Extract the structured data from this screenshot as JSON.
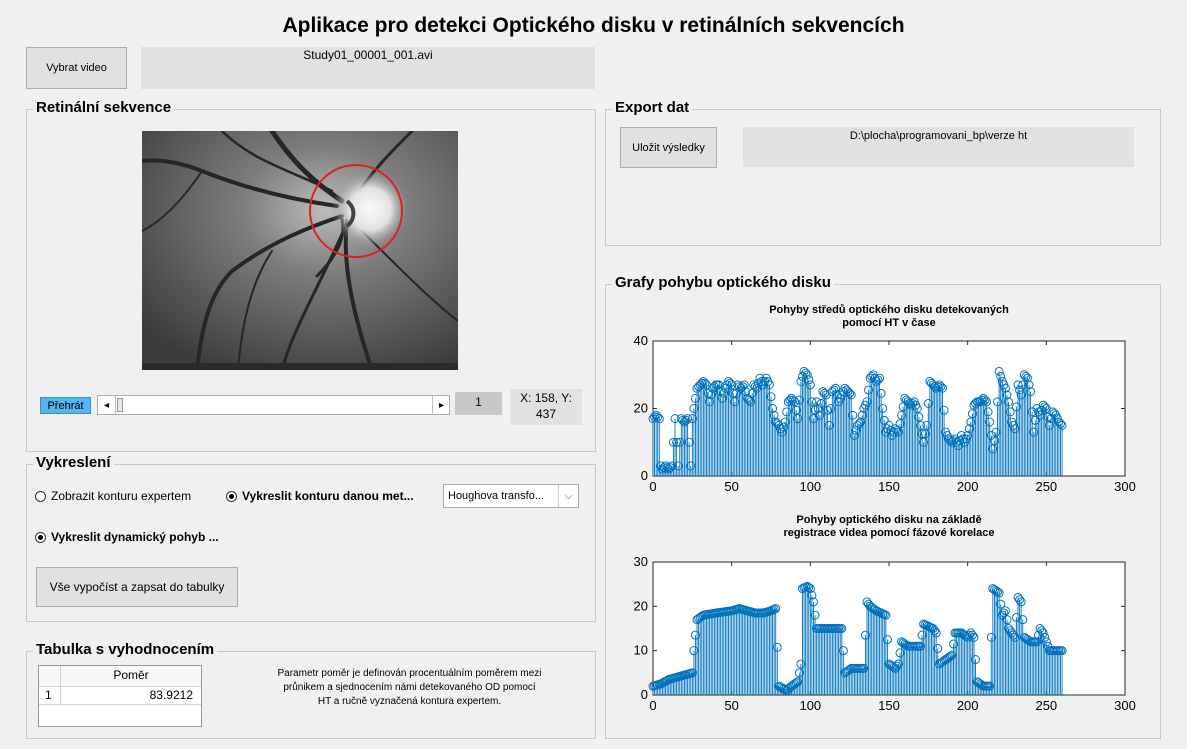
{
  "app_title": "Aplikace pro detekci Optického disku v retinálních sekvencích",
  "select_video_label": "Vybrat video",
  "video_filename": "Study01_00001_001.avi",
  "retina_panel": {
    "title": "Retinální sekvence",
    "play_label": "Přehrát",
    "frame_value": "1",
    "coords": "X: 158, Y: 437"
  },
  "export_panel": {
    "title": "Export dat",
    "save_label": "Uložit výsledky",
    "path": "D:\\plocha\\programovani_bp\\verze ht"
  },
  "draw_panel": {
    "title": "Vykreslení",
    "radio_expert": "Zobrazit konturu expertem",
    "radio_method": "Vykreslit konturu danou met...",
    "method_select": "Houghova transfo...",
    "radio_dynamic": "Vykreslit dynamický pohyb ...",
    "compute_label": "Vše vypočíst a zapsat do tabulky"
  },
  "table_panel": {
    "title": "Tabulka s vyhodnocením",
    "header": "Poměr",
    "row_index": "1",
    "row_value": "83.9212",
    "description_lines": [
      "Parametr poměr je definován procentuálním poměrem mezi",
      "průnikem a sjednocením námi detekovaného OD pomocí",
      "HT a ručně vyznačená kontura expertem."
    ]
  },
  "graphs_panel": {
    "title": "Grafy pohybu optického disku"
  },
  "colors": {
    "stem": "#0072bd",
    "play_button": "#56b4f0",
    "contour": "#e02020"
  },
  "chart_data": [
    {
      "type": "stem",
      "title_lines": [
        "Pohyby středů optického disku detekovaných",
        "pomocí HT v čase"
      ],
      "xlim": [
        0,
        300
      ],
      "ylim": [
        0,
        40
      ],
      "xticks": [
        0,
        50,
        100,
        150,
        200,
        250,
        300
      ],
      "yticks": [
        0,
        20,
        40
      ],
      "anchors": [
        [
          0,
          17
        ],
        [
          2,
          18
        ],
        [
          4,
          17
        ],
        [
          5,
          3
        ],
        [
          6,
          2
        ],
        [
          8,
          3
        ],
        [
          10,
          2
        ],
        [
          12,
          3
        ],
        [
          14,
          17
        ],
        [
          16,
          3
        ],
        [
          18,
          17
        ],
        [
          20,
          16
        ],
        [
          22,
          17
        ],
        [
          24,
          3
        ],
        [
          25,
          17
        ],
        [
          26,
          20
        ],
        [
          28,
          26
        ],
        [
          30,
          27
        ],
        [
          32,
          28
        ],
        [
          34,
          27
        ],
        [
          36,
          22
        ],
        [
          38,
          26
        ],
        [
          40,
          27
        ],
        [
          42,
          27
        ],
        [
          44,
          23
        ],
        [
          46,
          26
        ],
        [
          48,
          28
        ],
        [
          50,
          27
        ],
        [
          52,
          22
        ],
        [
          54,
          27
        ],
        [
          56,
          26
        ],
        [
          58,
          27
        ],
        [
          60,
          23
        ],
        [
          62,
          22
        ],
        [
          64,
          27
        ],
        [
          66,
          26
        ],
        [
          68,
          29
        ],
        [
          70,
          27
        ],
        [
          72,
          29
        ],
        [
          74,
          27
        ],
        [
          76,
          20
        ],
        [
          78,
          16
        ],
        [
          80,
          15
        ],
        [
          82,
          13
        ],
        [
          84,
          16
        ],
        [
          86,
          22
        ],
        [
          88,
          23
        ],
        [
          90,
          22
        ],
        [
          92,
          17
        ],
        [
          94,
          28
        ],
        [
          96,
          31
        ],
        [
          98,
          30
        ],
        [
          100,
          27
        ],
        [
          102,
          17
        ],
        [
          104,
          22
        ],
        [
          106,
          18
        ],
        [
          108,
          25
        ],
        [
          110,
          24
        ],
        [
          112,
          15
        ],
        [
          114,
          25
        ],
        [
          116,
          26
        ],
        [
          118,
          22
        ],
        [
          120,
          24
        ],
        [
          122,
          26
        ],
        [
          124,
          25
        ],
        [
          126,
          24
        ],
        [
          128,
          12
        ],
        [
          130,
          15
        ],
        [
          132,
          16
        ],
        [
          134,
          20
        ],
        [
          136,
          22
        ],
        [
          138,
          29
        ],
        [
          140,
          30
        ],
        [
          142,
          28
        ],
        [
          144,
          29
        ],
        [
          146,
          20
        ],
        [
          148,
          13
        ],
        [
          150,
          15
        ],
        [
          152,
          12
        ],
        [
          154,
          14
        ],
        [
          156,
          13
        ],
        [
          158,
          18
        ],
        [
          160,
          23
        ],
        [
          162,
          22
        ],
        [
          164,
          21
        ],
        [
          166,
          22
        ],
        [
          168,
          20
        ],
        [
          170,
          15
        ],
        [
          172,
          10
        ],
        [
          174,
          15
        ],
        [
          176,
          28
        ],
        [
          178,
          27
        ],
        [
          180,
          26
        ],
        [
          182,
          27
        ],
        [
          184,
          26
        ],
        [
          186,
          13
        ],
        [
          188,
          11
        ],
        [
          190,
          10
        ],
        [
          192,
          11
        ],
        [
          194,
          9
        ],
        [
          196,
          12
        ],
        [
          198,
          10
        ],
        [
          200,
          12
        ],
        [
          202,
          16
        ],
        [
          204,
          21
        ],
        [
          206,
          22
        ],
        [
          208,
          22
        ],
        [
          210,
          23
        ],
        [
          212,
          22
        ],
        [
          214,
          16
        ],
        [
          216,
          8
        ],
        [
          218,
          13
        ],
        [
          220,
          31
        ],
        [
          222,
          28
        ],
        [
          224,
          26
        ],
        [
          226,
          22
        ],
        [
          228,
          16
        ],
        [
          230,
          14
        ],
        [
          232,
          27
        ],
        [
          234,
          24
        ],
        [
          236,
          30
        ],
        [
          238,
          29
        ],
        [
          240,
          25
        ],
        [
          242,
          13
        ],
        [
          244,
          20
        ],
        [
          246,
          18
        ],
        [
          248,
          21
        ],
        [
          250,
          20
        ],
        [
          252,
          15
        ],
        [
          254,
          19
        ],
        [
          256,
          18
        ],
        [
          258,
          16
        ],
        [
          260,
          15
        ]
      ]
    },
    {
      "type": "stem",
      "title_lines": [
        "Pohyby optického disku na základě",
        "registrace videa pomocí fázové korelace"
      ],
      "xlim": [
        0,
        300
      ],
      "ylim": [
        0,
        30
      ],
      "xticks": [
        0,
        50,
        100,
        150,
        200,
        250,
        300
      ],
      "yticks": [
        0,
        10,
        20,
        30
      ],
      "anchors": [
        [
          0,
          2
        ],
        [
          5,
          2.5
        ],
        [
          10,
          3.5
        ],
        [
          15,
          4
        ],
        [
          20,
          4.5
        ],
        [
          25,
          5
        ],
        [
          26,
          10
        ],
        [
          28,
          17
        ],
        [
          32,
          18
        ],
        [
          40,
          18.5
        ],
        [
          50,
          19
        ],
        [
          55,
          19.5
        ],
        [
          60,
          19
        ],
        [
          65,
          18.5
        ],
        [
          70,
          18.5
        ],
        [
          75,
          19
        ],
        [
          78,
          19.5
        ],
        [
          80,
          2
        ],
        [
          85,
          1
        ],
        [
          88,
          2
        ],
        [
          90,
          2.5
        ],
        [
          92,
          3
        ],
        [
          94,
          7
        ],
        [
          95,
          24
        ],
        [
          98,
          24.5
        ],
        [
          100,
          24
        ],
        [
          102,
          21
        ],
        [
          104,
          15
        ],
        [
          110,
          15
        ],
        [
          115,
          15
        ],
        [
          120,
          15
        ],
        [
          122,
          5
        ],
        [
          126,
          6
        ],
        [
          130,
          6
        ],
        [
          134,
          6
        ],
        [
          136,
          21
        ],
        [
          138,
          20
        ],
        [
          142,
          19
        ],
        [
          148,
          18
        ],
        [
          150,
          7
        ],
        [
          154,
          6
        ],
        [
          156,
          7
        ],
        [
          158,
          12
        ],
        [
          162,
          11
        ],
        [
          166,
          11
        ],
        [
          170,
          11
        ],
        [
          172,
          16
        ],
        [
          178,
          15
        ],
        [
          180,
          14
        ],
        [
          182,
          7
        ],
        [
          186,
          8
        ],
        [
          190,
          9
        ],
        [
          192,
          14
        ],
        [
          196,
          14
        ],
        [
          200,
          13
        ],
        [
          202,
          14
        ],
        [
          204,
          13
        ],
        [
          206,
          3
        ],
        [
          210,
          2
        ],
        [
          214,
          2
        ],
        [
          216,
          24
        ],
        [
          220,
          23
        ],
        [
          222,
          18
        ],
        [
          224,
          19
        ],
        [
          226,
          15
        ],
        [
          228,
          14
        ],
        [
          230,
          13
        ],
        [
          232,
          22
        ],
        [
          234,
          21
        ],
        [
          236,
          13
        ],
        [
          240,
          12
        ],
        [
          244,
          12
        ],
        [
          246,
          15
        ],
        [
          248,
          14
        ],
        [
          250,
          12
        ],
        [
          252,
          10
        ],
        [
          254,
          10
        ],
        [
          258,
          10
        ],
        [
          260,
          10
        ]
      ]
    }
  ]
}
